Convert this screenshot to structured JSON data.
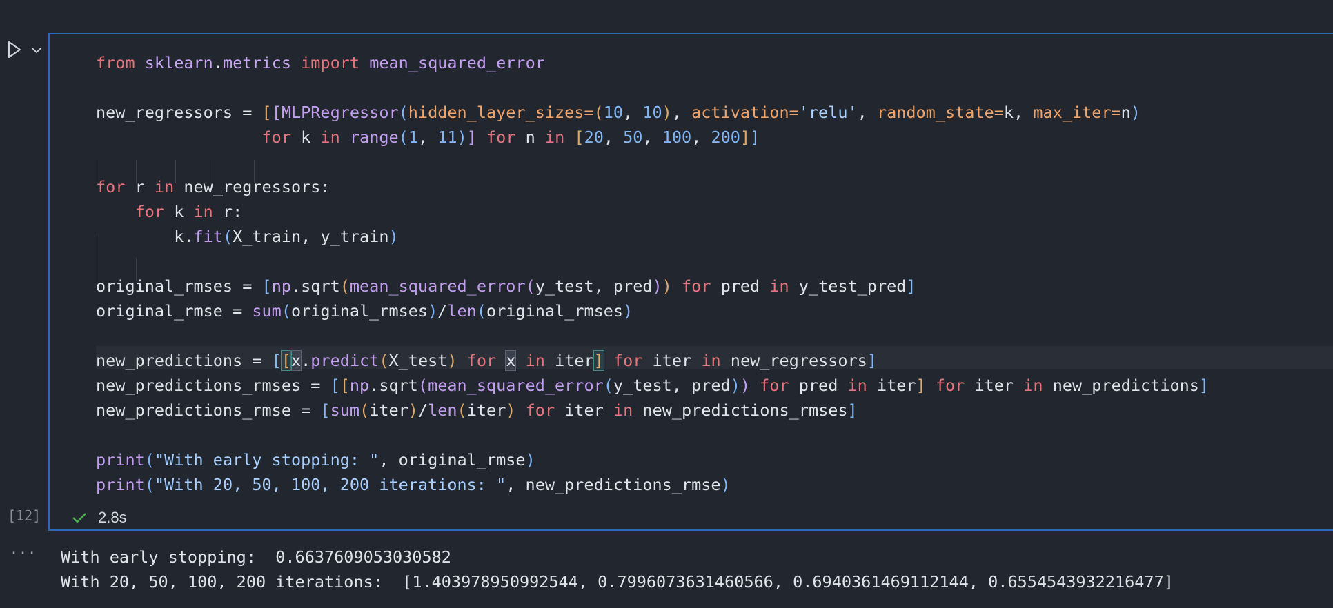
{
  "cell": {
    "execution_count": "[12]",
    "status_text": "2.8s",
    "run_icon": "play-icon",
    "expand_icon": "chevron-down-icon",
    "status_icon": "check-icon",
    "output_menu": "···"
  },
  "code": {
    "line1": {
      "kw_from": "from",
      "mod": "sklearn",
      "dot": ".",
      "mod2": "metrics",
      "kw_import": "import",
      "name": "mean_squared_error"
    },
    "line3": {
      "lhs": "new_regressors",
      "eq": " = ",
      "b1": "[",
      "b2": "[",
      "cls": "MLPRegressor",
      "p1": "(",
      "arg1": "hidden_layer_sizes",
      "eq1": "=",
      "p2": "(",
      "n1": "10",
      "c1": ", ",
      "n2": "10",
      "p3": ")",
      "c2": ", ",
      "arg2": "activation",
      "eq2": "=",
      "s1": "'relu'",
      "c3": ", ",
      "arg3": "random_state",
      "eq3": "=",
      "v3": "k",
      "c4": ", ",
      "arg4": "max_iter",
      "eq4": "=",
      "v4": "n",
      "p4": ")"
    },
    "line4": {
      "kw_for": "for",
      "v": "k",
      "kw_in": "in",
      "fn": "range",
      "p1": "(",
      "n1": "1",
      "c1": ", ",
      "n2": "11",
      "p2": ")",
      "b1": "]",
      "kw_for2": "for",
      "v2": "n",
      "kw_in2": "in",
      "b2": "[",
      "n3": "20",
      "c2": ", ",
      "n4": "50",
      "c3": ", ",
      "n5": "100",
      "c4": ", ",
      "n6": "200",
      "b3": "]",
      "b4": "]"
    },
    "line6": {
      "kw_for": "for",
      "v": "r",
      "kw_in": "in",
      "rest": "new_regressors:"
    },
    "line7": {
      "kw_for": "for",
      "v": "k",
      "kw_in": "in",
      "rest": "r:"
    },
    "line8": {
      "obj": "k",
      "dot": ".",
      "fn": "fit",
      "p1": "(",
      "args": "X_train, y_train",
      "p2": ")"
    },
    "line10": {
      "lhs": "original_rmses = ",
      "b1": "[",
      "mod": "np",
      "dot": ".",
      "fn": "sqrt",
      "p1": "(",
      "fn2": "mean_squared_error",
      "p2": "(",
      "args": "y_test, pred",
      "p3": ")",
      "p4": ")",
      "kw_for": "for",
      "v": "pred",
      "kw_in": "in",
      "it": "y_test_pred",
      "b2": "]"
    },
    "line11": {
      "lhs": "original_rmse = ",
      "fn": "sum",
      "p1": "(",
      "a1": "original_rmses",
      "p2": ")",
      "op": "/",
      "fn2": "len",
      "p3": "(",
      "a2": "original_rmses",
      "p4": ")"
    },
    "line13": {
      "lhs": "new_predictions = ",
      "b1": "[",
      "b2": "[",
      "v": "x",
      "dot": ".",
      "fn": "predict",
      "p1": "(",
      "arg": "X_test",
      "p2": ")",
      "kw_for": "for",
      "v2": "x",
      "kw_in": "in",
      "it": "iter",
      "b3": "]",
      "kw_for2": "for",
      "v3": "iter",
      "kw_in2": "in",
      "it2": "new_regressors",
      "b4": "]"
    },
    "line14": {
      "lhs": "new_predictions_rmses = ",
      "b1": "[",
      "b2": "[",
      "mod": "np",
      "dot": ".",
      "fn": "sqrt",
      "p1": "(",
      "fn2": "mean_squared_error",
      "p2": "(",
      "args": "y_test, pred",
      "p3": ")",
      "p4": ")",
      "kw_for": "for",
      "v": "pred",
      "kw_in": "in",
      "it": "iter",
      "b3": "]",
      "kw_for2": "for",
      "v2": "iter",
      "kw_in2": "in",
      "it2": "new_predictions",
      "b4": "]"
    },
    "line15": {
      "lhs": "new_predictions_rmse = ",
      "b1": "[",
      "fn": "sum",
      "p1": "(",
      "a1": "iter",
      "p2": ")",
      "op": "/",
      "fn2": "len",
      "p3": "(",
      "a2": "iter",
      "p4": ")",
      "kw_for": "for",
      "v": "iter",
      "kw_in": "in",
      "it": "new_predictions_rmses",
      "b2": "]"
    },
    "line17": {
      "fn": "print",
      "p1": "(",
      "s": "\"With early stopping: \"",
      "rest": ", original_rmse",
      "p2": ")"
    },
    "line18": {
      "fn": "print",
      "p1": "(",
      "s": "\"With 20, 50, 100, 200 iterations: \"",
      "rest": ", new_predictions_rmse",
      "p2": ")"
    }
  },
  "output": {
    "line1": "With early stopping:  0.6637609053030582",
    "line2": "With 20, 50, 100, 200 iterations:  [1.403978950992544, 0.7996073631460566, 0.6940361469112144, 0.6554543932216477]"
  },
  "colors": {
    "background": "#22262e",
    "cell_border": "#2f67b8",
    "keyword": "#e5747d",
    "function": "#c29df0",
    "number": "#82b6f5",
    "param": "#f0a46a",
    "success": "#4caf50"
  }
}
